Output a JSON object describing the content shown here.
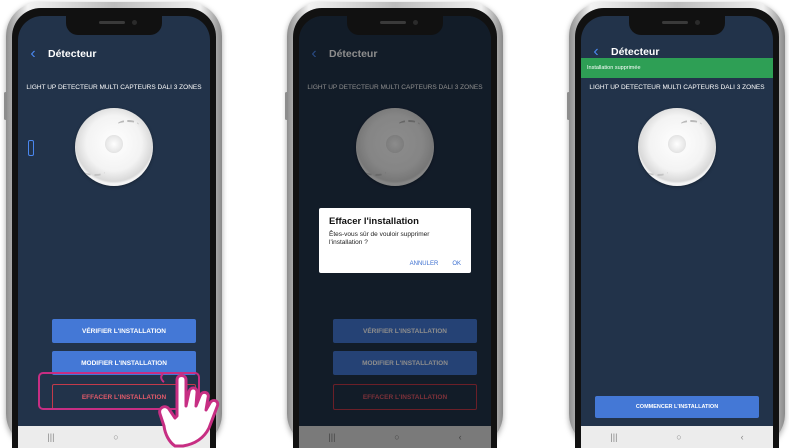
{
  "colors": {
    "screen_bg": "#22334a",
    "accent": "#4478d6",
    "danger": "#c33a4a",
    "toast": "#2e9f55",
    "highlight": "#c72e83"
  },
  "phones": [
    {
      "header_title": "Détecteur",
      "device_name": "LIGHT UP DETECTEUR MULTI CAPTEURS DALI 3 ZONES",
      "buttons": [
        "VÉRIFIER L'INSTALLATION",
        "MODIFIER L'INSTALLATION",
        "EFFACER L'INSTALLATION"
      ],
      "nav": [
        "|||",
        "○",
        "‹"
      ]
    },
    {
      "header_title": "Détecteur",
      "device_name": "LIGHT UP DETECTEUR MULTI CAPTEURS DALI 3 ZONES",
      "buttons": [
        "VÉRIFIER L'INSTALLATION",
        "MODIFIER L'INSTALLATION",
        "EFFACER L'INSTALLATION"
      ],
      "dialog": {
        "title": "Effacer l'installation",
        "message": "Êtes-vous sûr de vouloir supprimer l'installation ?",
        "cancel": "ANNULER",
        "ok": "OK"
      },
      "nav": [
        "|||",
        "○",
        "‹"
      ]
    },
    {
      "header_title": "Détecteur",
      "toast": "Installation supprimée",
      "device_name": "LIGHT UP DETECTEUR MULTI CAPTEURS DALI 3 ZONES",
      "start_button": "COMMENCER L'INSTALLATION",
      "nav": [
        "|||",
        "○",
        "‹"
      ]
    }
  ]
}
